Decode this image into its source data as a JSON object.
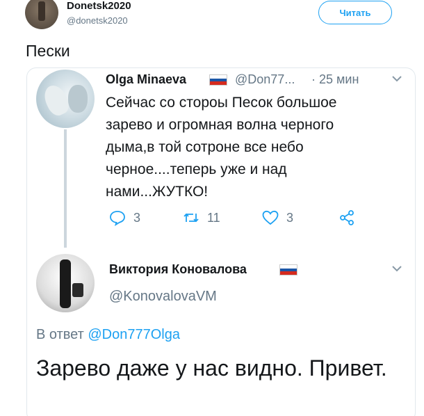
{
  "author": {
    "name": "Donetsk2020",
    "handle": "@donetsk2020",
    "follow_label": "Читать"
  },
  "tweet_text": "Пески",
  "quoted": {
    "name": "Olga Minaeva",
    "handle": "@Don77...",
    "time": "· 25 мин",
    "text": "Сейчас со стороы Песок большое зарево и огромная волна черного дыма,в той сотроне все небо черное....теперь уже и над нами...ЖУТКО!",
    "actions": {
      "reply_count": "3",
      "retweet_count": "11",
      "like_count": "3"
    }
  },
  "reply": {
    "name": "Виктория Коновалова",
    "handle": "@KonovalovaVM",
    "reply_to_prefix": "В ответ",
    "reply_to_handle": "@Don777Olga",
    "text": "Зарево даже у нас видно. Привет."
  },
  "icons": {
    "flag": "russian-flag-icon",
    "reply": "reply-icon",
    "retweet": "retweet-icon",
    "like": "heart-icon",
    "share": "share-icon",
    "more": "chevron-down-icon"
  },
  "colors": {
    "accent": "#1da1f2",
    "secondary_text": "#657786",
    "border": "#e1e8ed"
  }
}
